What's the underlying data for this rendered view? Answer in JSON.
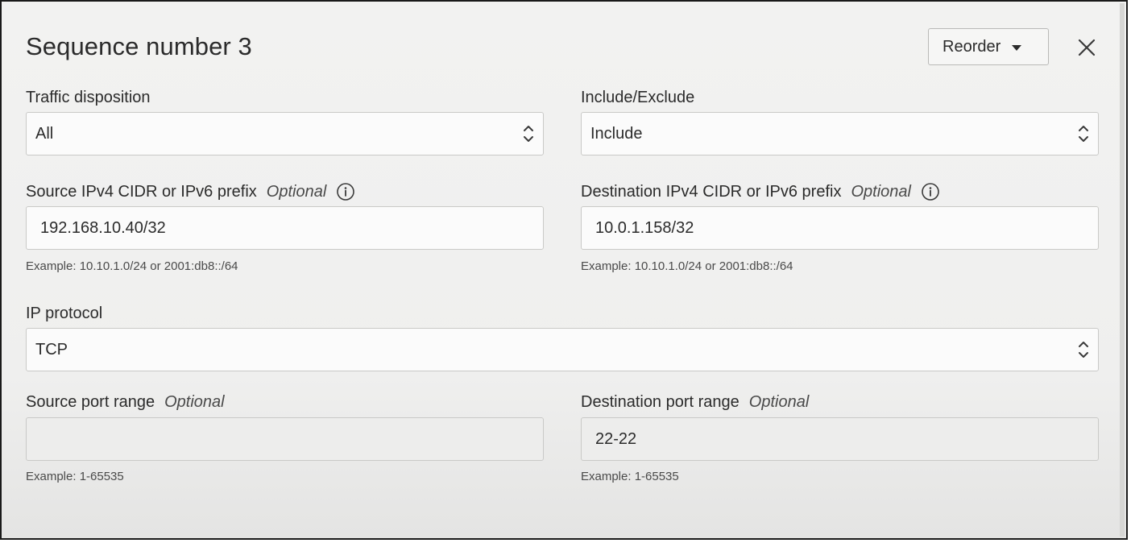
{
  "dialog": {
    "title": "Sequence number 3",
    "reorder_label": "Reorder",
    "close_icon": "close-icon"
  },
  "traffic_disposition": {
    "label": "Traffic disposition",
    "value": "All"
  },
  "include_exclude": {
    "label": "Include/Exclude",
    "value": "Include"
  },
  "source_cidr": {
    "label": "Source IPv4 CIDR or IPv6 prefix",
    "optional": "Optional",
    "value": "192.168.10.40/32",
    "help": "Example: 10.10.1.0/24 or 2001:db8::/64"
  },
  "destination_cidr": {
    "label": "Destination IPv4 CIDR or IPv6 prefix",
    "optional": "Optional",
    "value": "10.0.1.158/32",
    "help": "Example: 10.10.1.0/24 or 2001:db8::/64"
  },
  "ip_protocol": {
    "label": "IP protocol",
    "value": "TCP"
  },
  "source_port": {
    "label": "Source port range",
    "optional": "Optional",
    "value": "",
    "help": "Example: 1-65535"
  },
  "destination_port": {
    "label": "Destination port range",
    "optional": "Optional",
    "value": "22-22",
    "help": "Example: 1-65535"
  },
  "icons": {
    "info": "info-icon",
    "updown": "up-down-chevron-icon",
    "caret": "caret-down-icon"
  }
}
